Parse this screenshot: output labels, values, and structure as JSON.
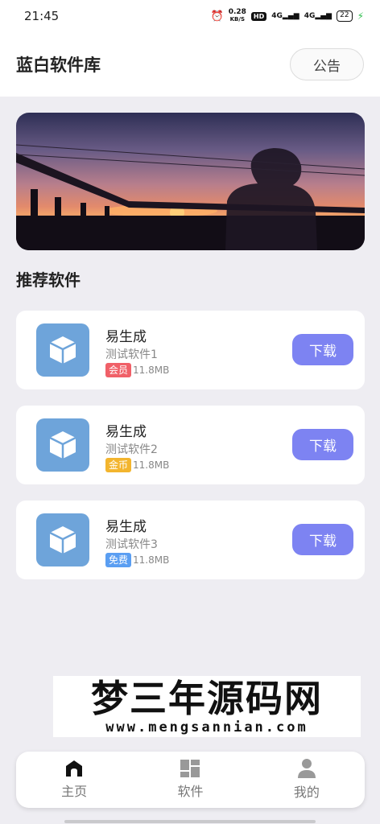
{
  "status_bar": {
    "time": "21:45",
    "net_speed_value": "0.28",
    "net_speed_unit": "KB/S",
    "hd_badge": "HD",
    "signal_1": "4G",
    "signal_2": "4G",
    "battery": "22"
  },
  "header": {
    "title": "蓝白软件库",
    "notice_label": "公告"
  },
  "section": {
    "title": "推荐软件"
  },
  "apps": [
    {
      "name": "易生成",
      "desc": "测试软件1",
      "tag": "会员",
      "tag_color": "#f06068",
      "size": "11.8MB",
      "download_label": "下载"
    },
    {
      "name": "易生成",
      "desc": "测试软件2",
      "tag": "金币",
      "tag_color": "#f3b52e",
      "size": "11.8MB",
      "download_label": "下载"
    },
    {
      "name": "易生成",
      "desc": "测试软件3",
      "tag": "免费",
      "tag_color": "#5a9ef2",
      "size": "11.8MB",
      "download_label": "下载"
    }
  ],
  "watermark": {
    "chinese": "梦三年源码网",
    "url": "www.mengsannian.com"
  },
  "bottom_nav": [
    {
      "label": "主页",
      "icon": "home-icon",
      "active": true
    },
    {
      "label": "软件",
      "icon": "grid-icon",
      "active": false
    },
    {
      "label": "我的",
      "icon": "user-icon",
      "active": false
    }
  ],
  "colors": {
    "accent": "#7d83f2",
    "app_icon_bg": "#6ea4da",
    "background": "#eeedf2"
  }
}
